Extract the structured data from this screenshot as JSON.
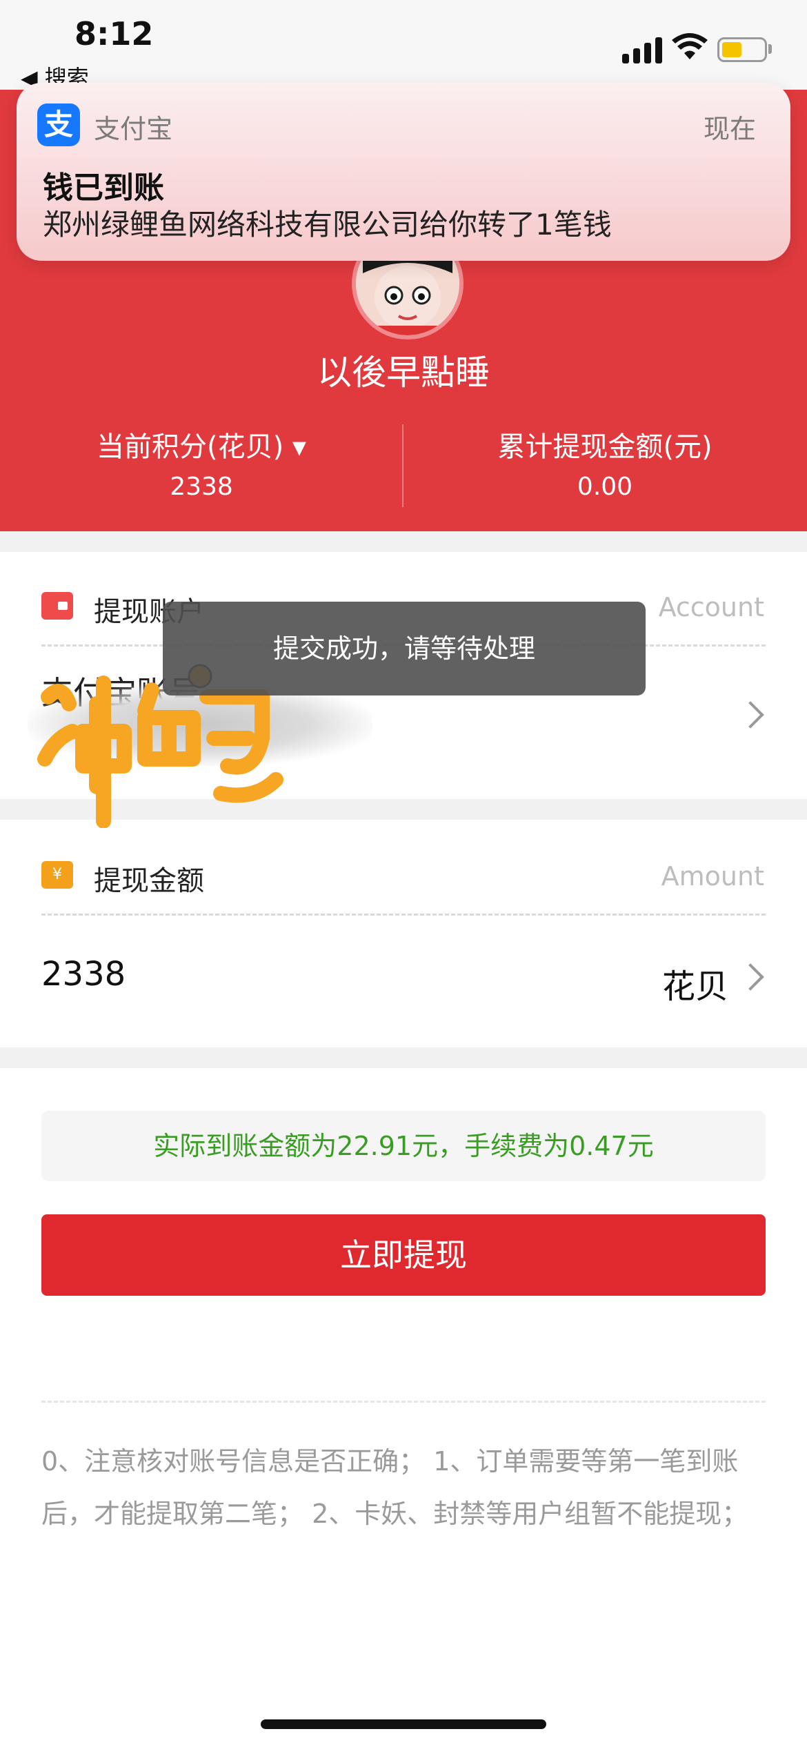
{
  "status_bar": {
    "time": "8:12",
    "back_label": "◀ 搜索",
    "battery_color": "#f5c400"
  },
  "notification": {
    "app_name": "支付宝",
    "app_icon_glyph": "支",
    "time": "现在",
    "title": "钱已到账",
    "body": "郑州绿鲤鱼网络科技有限公司给你转了1笔钱"
  },
  "profile": {
    "username": "以後早點睡",
    "stats": [
      {
        "label": "当前积分(花贝) ▾",
        "value": "2338"
      },
      {
        "label": "累计提现金额(元)",
        "value": "0.00"
      }
    ]
  },
  "account_section": {
    "title": "提现账户",
    "title_en": "Account",
    "value": "支付宝账号"
  },
  "amount_section": {
    "title": "提现金额",
    "title_en": "Amount",
    "value": "2338",
    "unit": "花贝",
    "icon_glyph": "¥"
  },
  "info": {
    "text": "实际到账金额为22.91元，手续费为0.47元"
  },
  "withdraw_button": {
    "label": "立即提现"
  },
  "notes": {
    "text": "0、注意核对账号信息是否正确； 1、订单需要等第一笔到账后，才能提取第二笔； 2、卡妖、封禁等用户组暂不能提现；"
  },
  "toast": {
    "text": "提交成功，请等待处理"
  },
  "watermark": {
    "text": "冲鸭"
  },
  "colors": {
    "header_red": "#e03a3e",
    "button_red": "#e0282f",
    "info_green": "#3a9d23",
    "alipay_blue": "#1677ff"
  }
}
